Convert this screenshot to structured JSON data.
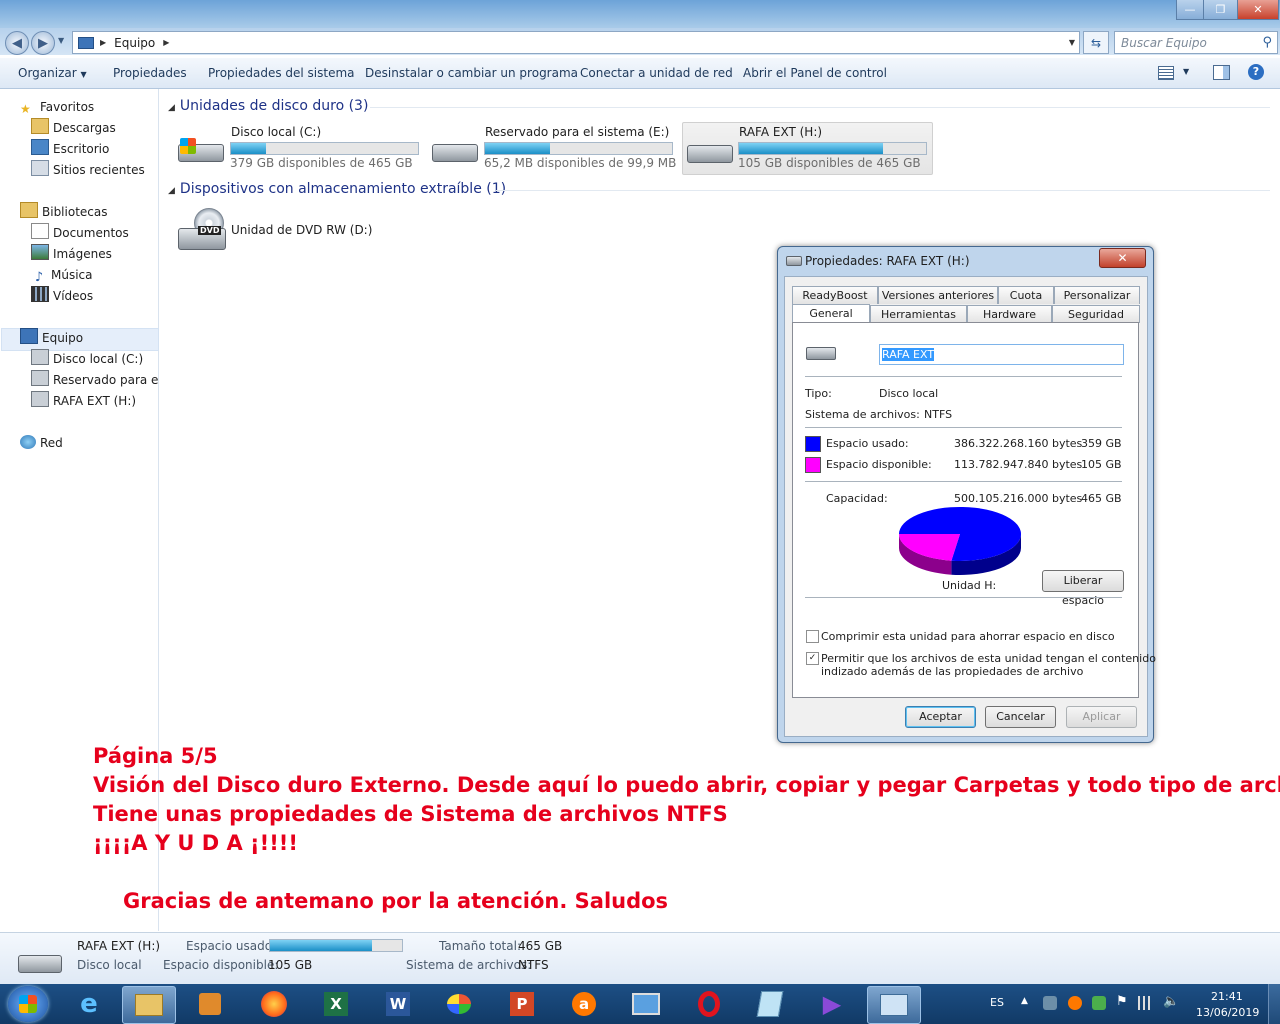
{
  "window": {
    "controls": {
      "minimize": "—",
      "maximize": "❐",
      "close": "✕"
    }
  },
  "address": {
    "path": "Equipo",
    "search_placeholder": "Buscar Equipo"
  },
  "toolbar": {
    "organize": "Organizar",
    "properties": "Propiedades",
    "system_properties": "Propiedades del sistema",
    "uninstall": "Desinstalar o cambiar un programa",
    "map_drive": "Conectar a unidad de red",
    "control_panel": "Abrir el Panel de control"
  },
  "nav": {
    "favorites": "Favoritos",
    "downloads": "Descargas",
    "desktop": "Escritorio",
    "recent": "Sitios recientes",
    "libraries": "Bibliotecas",
    "documents": "Documentos",
    "images": "Imágenes",
    "music": "Música",
    "videos": "Vídeos",
    "computer": "Equipo",
    "local_c": "Disco local (C:)",
    "reserved": "Reservado para el sis",
    "rafa": "RAFA EXT (H:)",
    "network": "Red"
  },
  "content": {
    "hdd_group": "Unidades de disco duro (3)",
    "removable_group": "Dispositivos con almacenamiento extraíble (1)",
    "drives": [
      {
        "name": "Disco local (C:)",
        "free": "379 GB disponibles de 465 GB",
        "used_fraction": 0.185
      },
      {
        "name": "Reservado para el sistema (E:)",
        "free": "65,2 MB disponibles de 99,9 MB",
        "used_fraction": 0.35
      },
      {
        "name": "RAFA EXT (H:)",
        "free": "105 GB disponibles de 465 GB",
        "used_fraction": 0.77
      }
    ],
    "dvd": {
      "name": "Unidad de DVD RW (D:)",
      "icon_text": "DVD"
    }
  },
  "dialog": {
    "title": "Propiedades: RAFA EXT (H:)",
    "tabs_top": [
      "ReadyBoost",
      "Versiones anteriores",
      "Cuota",
      "Personalizar"
    ],
    "tabs_bottom": [
      "General",
      "Herramientas",
      "Hardware",
      "Seguridad"
    ],
    "name_value": "RAFA EXT",
    "type_label": "Tipo:",
    "type_value": "Disco local",
    "fs_label": "Sistema de archivos:",
    "fs_value": "NTFS",
    "used_label": "Espacio usado:",
    "used_bytes": "386.322.268.160 bytes",
    "used_gb": "359 GB",
    "free_label": "Espacio disponible:",
    "free_bytes": "113.782.947.840 bytes",
    "free_gb": "105 GB",
    "capacity_label": "Capacidad:",
    "capacity_bytes": "500.105.216.000 bytes",
    "capacity_gb": "465 GB",
    "drive_label": "Unidad H:",
    "cleanup": "Liberar espacio",
    "compress": "Comprimir esta unidad para ahorrar espacio en disco",
    "index_line1": "Permitir que los archivos de esta unidad tengan el contenido",
    "index_line2": "indizado además de las propiedades de archivo",
    "compress_checked": false,
    "index_checked": true,
    "ok": "Aceptar",
    "cancel": "Cancelar",
    "apply": "Aplicar",
    "used_color": "#0000ff",
    "free_color": "#ff00ff",
    "used_fraction": 0.7725
  },
  "note": {
    "line1": "Página 5/5",
    "line2": "Visión del Disco duro Externo. Desde aquí lo puedo abrir, copiar y pegar Carpetas y todo tipo de archivos",
    "line3": "Tiene unas propiedades de Sistema de archivos NTFS",
    "line4": "¡¡¡¡A Y U D A ¡!!!!",
    "line5": "Gracias de antemano por la atención. Saludos",
    "color": "#e6001c"
  },
  "details": {
    "name": "RAFA EXT (H:)",
    "type": "Disco local",
    "used_label": "Espacio usado:",
    "free_label": "Espacio disponible:",
    "free_value": "105 GB",
    "total_label": "Tamaño total:",
    "total_value": "465 GB",
    "fs_label": "Sistema de archivos:",
    "fs_value": "NTFS",
    "used_fraction": 0.77
  },
  "taskbar": {
    "lang": "ES",
    "time": "21:41",
    "date": "13/06/2019"
  }
}
